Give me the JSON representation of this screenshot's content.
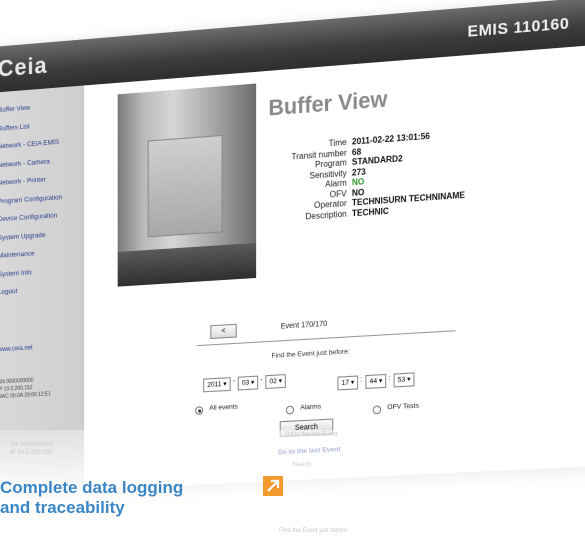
{
  "header": {
    "logo": "Ceia",
    "title": "EMIS 110160"
  },
  "sidebar": {
    "items": [
      "Buffer View",
      "Buffers List",
      "Network - CEIA EMIS",
      "Network - Camera",
      "Network - Printer",
      "Program Configuration",
      "Device Configuration",
      "System Upgrade",
      "Maintenance",
      "System Info",
      "Logout"
    ],
    "website": "www.ceia.net",
    "device_info": [
      "SN 0000000000",
      "IP 10.0.200.152",
      "MAC 00:0A:29:00:12:E1"
    ]
  },
  "main": {
    "title": "Buffer View",
    "details": [
      {
        "label": "Time",
        "value": "2011-02-22 13:01:56"
      },
      {
        "label": "Transit number",
        "value": "68"
      },
      {
        "label": "Program",
        "value": "STANDARD2"
      },
      {
        "label": "Sensitivity",
        "value": "273"
      },
      {
        "label": "Alarm",
        "value": "NO"
      },
      {
        "label": "OFV",
        "value": "NO"
      },
      {
        "label": "Operator",
        "value": "TECHNISURN TECHNINAME"
      },
      {
        "label": "Description",
        "value": "TECHNIC"
      }
    ],
    "prev_button": "<",
    "event_counter": "Event 170/170",
    "find_label": "Find the Event just before:",
    "date": {
      "year": "2011",
      "month": "03",
      "day": "02"
    },
    "time": {
      "hour": "17",
      "minute": "44",
      "second": "53"
    },
    "filters": {
      "all": "All events",
      "alarms": "Alarms",
      "ofv": "OFV Tests",
      "selected": "all"
    },
    "search_button": "Search",
    "last_event_link": "Go to the last Event"
  },
  "caption": {
    "line1": "Complete data logging",
    "line2": "and traceability"
  },
  "colors": {
    "caption": "#3a86c6",
    "badge": "#f29a2e",
    "green_value": "#2c9a2c"
  }
}
